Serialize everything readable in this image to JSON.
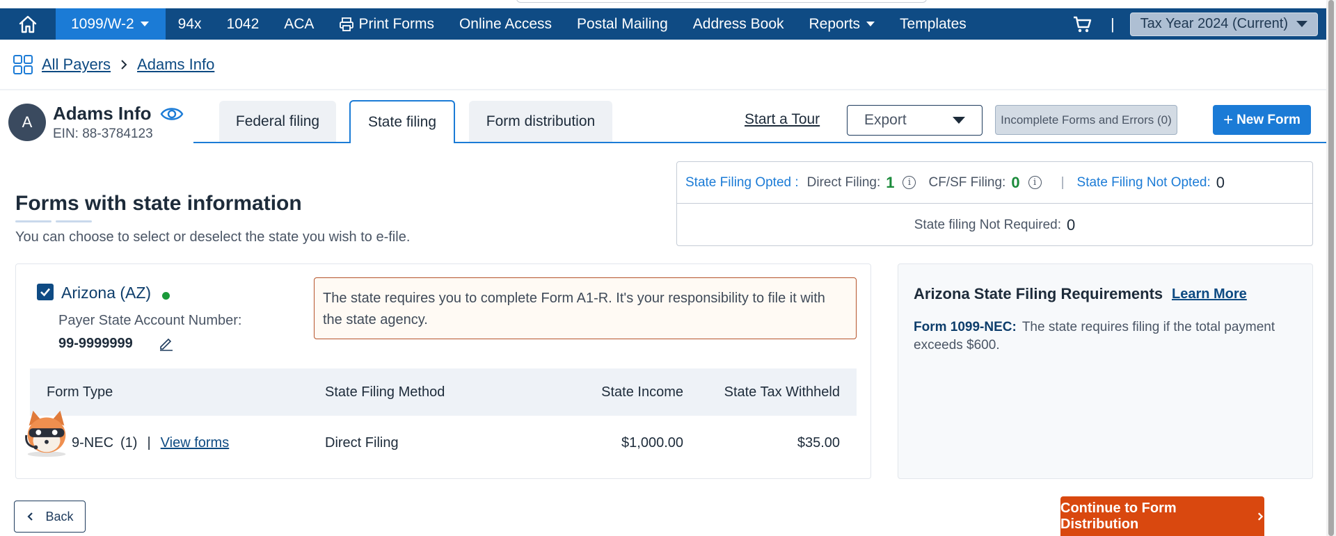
{
  "nav": {
    "home_icon": "home-icon",
    "items": [
      {
        "label": "1099/W-2",
        "dropdown": true,
        "active": true
      },
      {
        "label": "94x"
      },
      {
        "label": "1042"
      },
      {
        "label": "ACA"
      },
      {
        "label": "Print Forms",
        "icon": "printer-icon"
      },
      {
        "label": "Online Access"
      },
      {
        "label": "Postal Mailing"
      },
      {
        "label": "Address Book"
      },
      {
        "label": "Reports",
        "dropdown": true
      },
      {
        "label": "Templates"
      }
    ],
    "cart_icon": "cart-icon",
    "separator": "|",
    "tax_year": "Tax Year 2024 (Current)",
    "bg_color": "#0f4b84",
    "active_color": "#1b7bd6"
  },
  "breadcrumb": {
    "icon": "grid-icon",
    "items": [
      "All Payers",
      "Adams Info"
    ]
  },
  "payer": {
    "initial": "A",
    "name": "Adams Info",
    "ein": "EIN: 88-3784123"
  },
  "tabs": [
    {
      "label": "Federal filing"
    },
    {
      "label": "State filing",
      "active": true
    },
    {
      "label": "Form distribution"
    }
  ],
  "actions": {
    "tour": "Start a Tour",
    "export": "Export",
    "incomplete": "Incomplete Forms and Errors (0)",
    "new_form": "New Form"
  },
  "status": {
    "opted_label": "State Filing Opted :",
    "direct_label": "Direct Filing:",
    "direct_count": "1",
    "cfsf_label": "CF/SF Filing:",
    "cfsf_count": "0",
    "divider": "|",
    "not_opted_label": "State Filing Not Opted:",
    "not_opted_count": "0",
    "not_required_label": "State filing Not Required:",
    "not_required_count": "0"
  },
  "section": {
    "title": "Forms with state information",
    "subtitle": "You can choose to select or deselect the state you wish to e-file."
  },
  "state": {
    "checked": true,
    "name": "Arizona (AZ)",
    "status_color": "#1a9a3a",
    "acct_label": "Payer State Account Number:",
    "acct_number": "99-9999999",
    "notice": "The state requires you to complete Form A1-R. It's your responsibility to file it with the state agency.",
    "table": {
      "headers": [
        "Form Type",
        "State Filing Method",
        "State Income",
        "State Tax Withheld"
      ],
      "rows": [
        {
          "form_type": "9-NEC",
          "count": "(1)",
          "sep": "|",
          "view": "View forms",
          "method": "Direct Filing",
          "income": "$1,000.00",
          "withheld": "$35.00"
        }
      ]
    }
  },
  "requirements": {
    "title": "Arizona State Filing Requirements",
    "learn_more": "Learn More",
    "form": "Form 1099-NEC:",
    "text": "The state requires filing if the total payment exceeds $600."
  },
  "footer": {
    "back": "Back",
    "continue": "Continue to Form Distribution"
  }
}
